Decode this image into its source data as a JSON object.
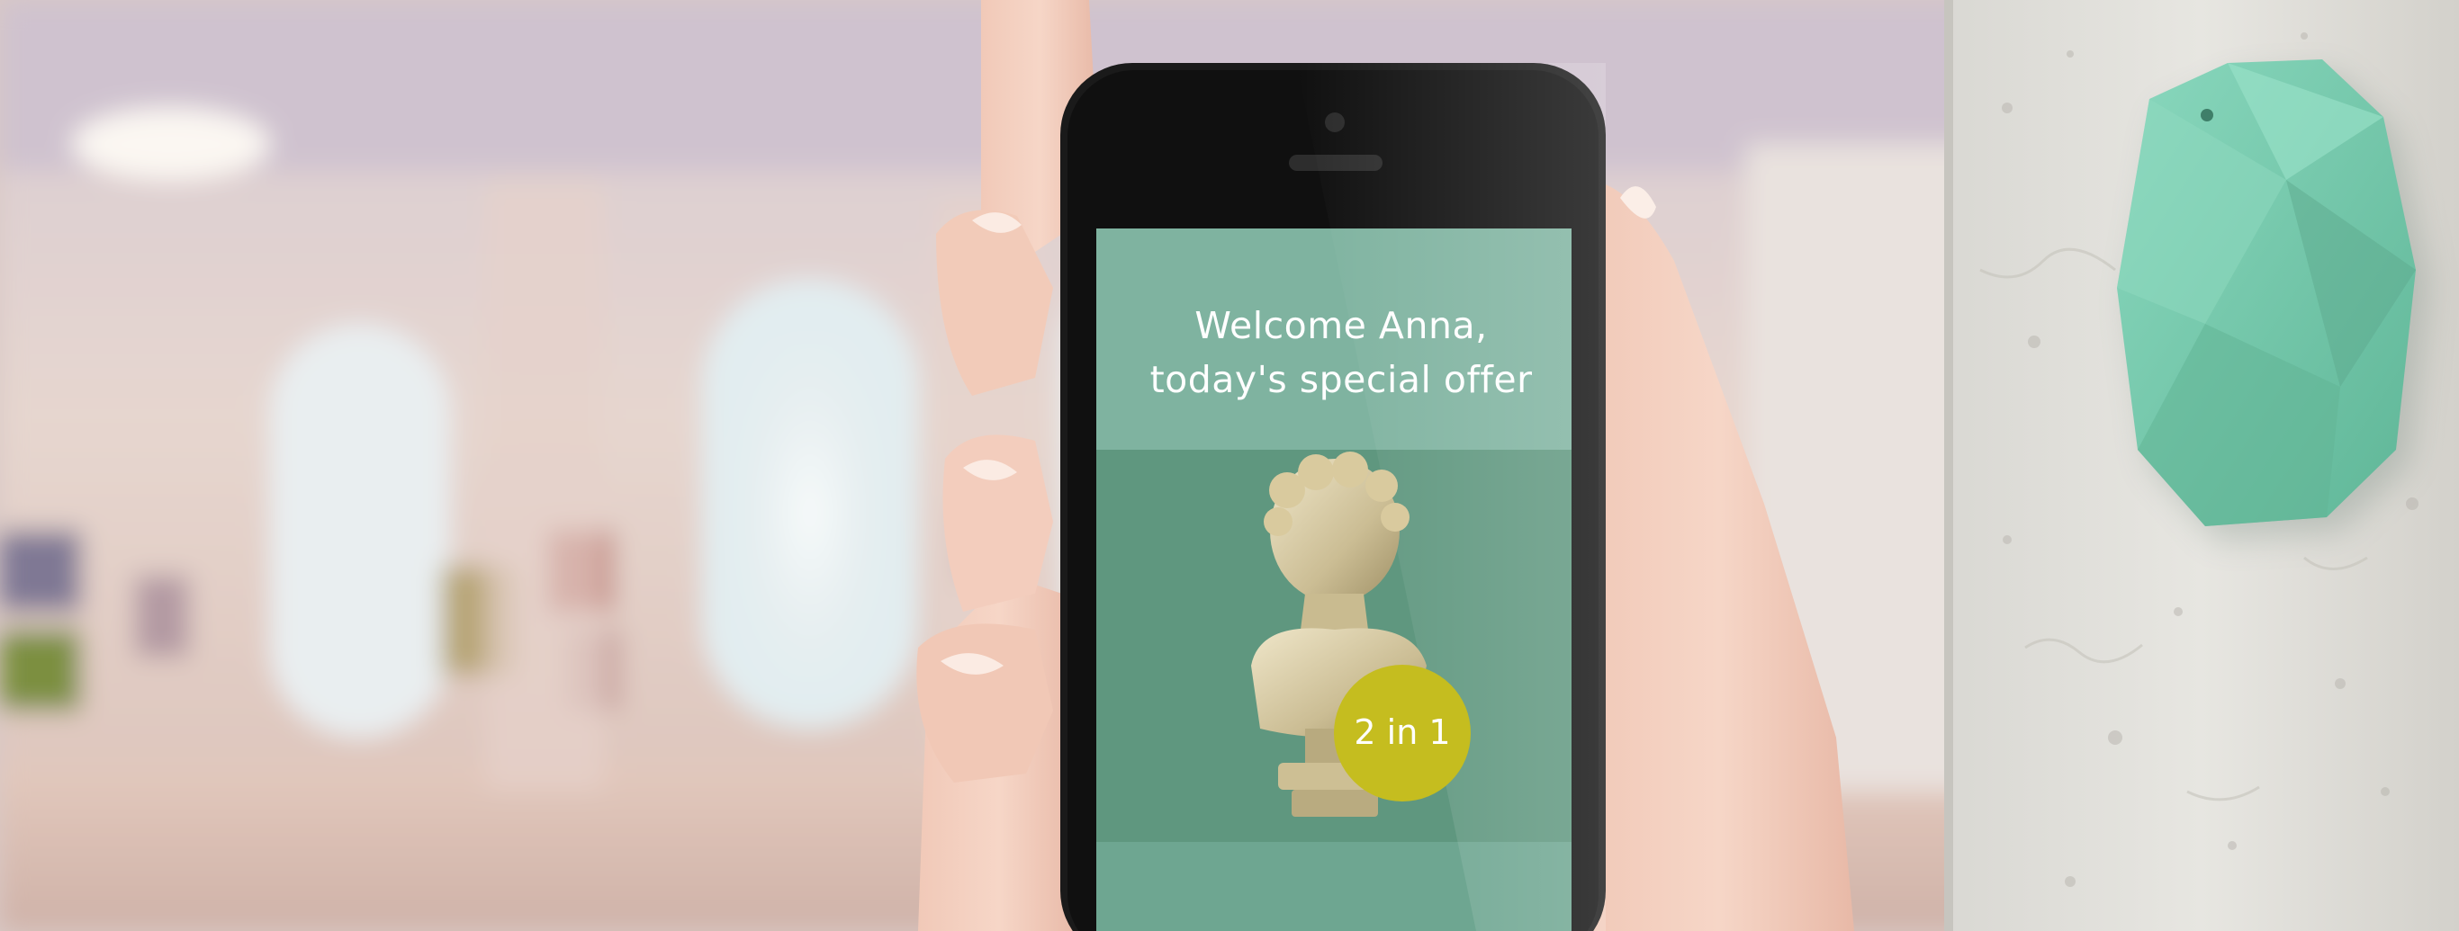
{
  "screen": {
    "greeting": "Welcome Anna,",
    "offer_title": "today's special offer",
    "badge_label": "2 in 1"
  },
  "icons": {
    "beacon": "beacon-device-icon",
    "bust": "statue-bust-icon"
  },
  "colors": {
    "screen_green": "#6fa592",
    "badge_yellow": "#c5bd1f",
    "beacon_mint": "#78cdb0",
    "phone_black": "#151515"
  }
}
